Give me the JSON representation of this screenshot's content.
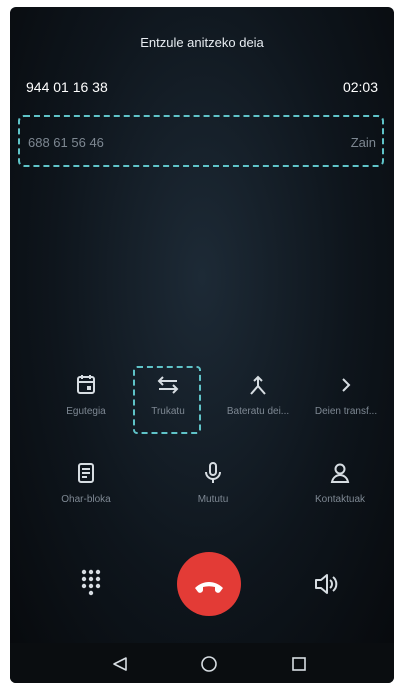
{
  "call": {
    "title": "Entzule anitzeko deia",
    "active_number": "944 01 16 38",
    "active_duration": "02:03",
    "hold_number": "688 61 56 46",
    "hold_status": "Zain"
  },
  "actions_row1": [
    {
      "label": "Egutegia",
      "icon": "calendar-icon"
    },
    {
      "label": "Trukatu",
      "icon": "swap-icon"
    },
    {
      "label": "Bateratu dei...",
      "icon": "merge-icon"
    },
    {
      "label": "Deien transf...",
      "icon": "chevron-right-icon"
    }
  ],
  "actions_row2": [
    {
      "label": "Ohar-bloka",
      "icon": "notepad-icon"
    },
    {
      "label": "Mututu",
      "icon": "microphone-icon"
    },
    {
      "label": "Kontaktuak",
      "icon": "contact-icon"
    }
  ],
  "colors": {
    "accent_dashed": "#5fc3c8",
    "end_call": "#e33b36",
    "background": "#0e151c"
  }
}
